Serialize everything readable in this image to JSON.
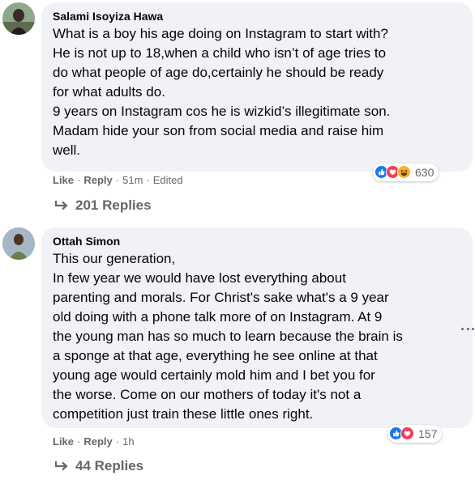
{
  "comments": [
    {
      "author": "Salami Isoyiza Hawa",
      "text": "What is a boy his age doing on Instagram to start with?\nHe is not up to 18,when a child who isn’t of age tries to\ndo what people of age do,certainly he should be ready\nfor what adults do.\n9 years on Instagram cos he is wizkid’s illegitimate son.\nMadam hide your son from social media and raise him\nwell.",
      "like_label": "Like",
      "reply_label": "Reply",
      "time": "51m",
      "edited": "Edited",
      "reactions": [
        "like-icon",
        "love-icon",
        "haha-icon"
      ],
      "reaction_count": "630",
      "replies_label": "201 Replies"
    },
    {
      "author": "Ottah Simon",
      "text": "This our generation,\nIn few year we would have lost everything about\nparenting and morals. For Christ's sake what's a 9 year\nold doing with a phone talk more of on Instagram. At 9\nthe young man has so much to learn because the brain is\na sponge at that age, everything he see online at that\nyoung age would certainly mold him and I bet you for\nthe worse. Come on our mothers of today it's not a\ncompetition just train these little ones right.",
      "like_label": "Like",
      "reply_label": "Reply",
      "time": "1h",
      "reactions": [
        "like-icon",
        "love-icon"
      ],
      "reaction_count": "157",
      "replies_label": "44 Replies"
    }
  ],
  "colors": {
    "bubble": "#f0f2f5",
    "secondary_text": "#65676b",
    "like_blue": "#1877f2",
    "love_red": "#f33e58",
    "haha_yellow": "#f7b125"
  }
}
